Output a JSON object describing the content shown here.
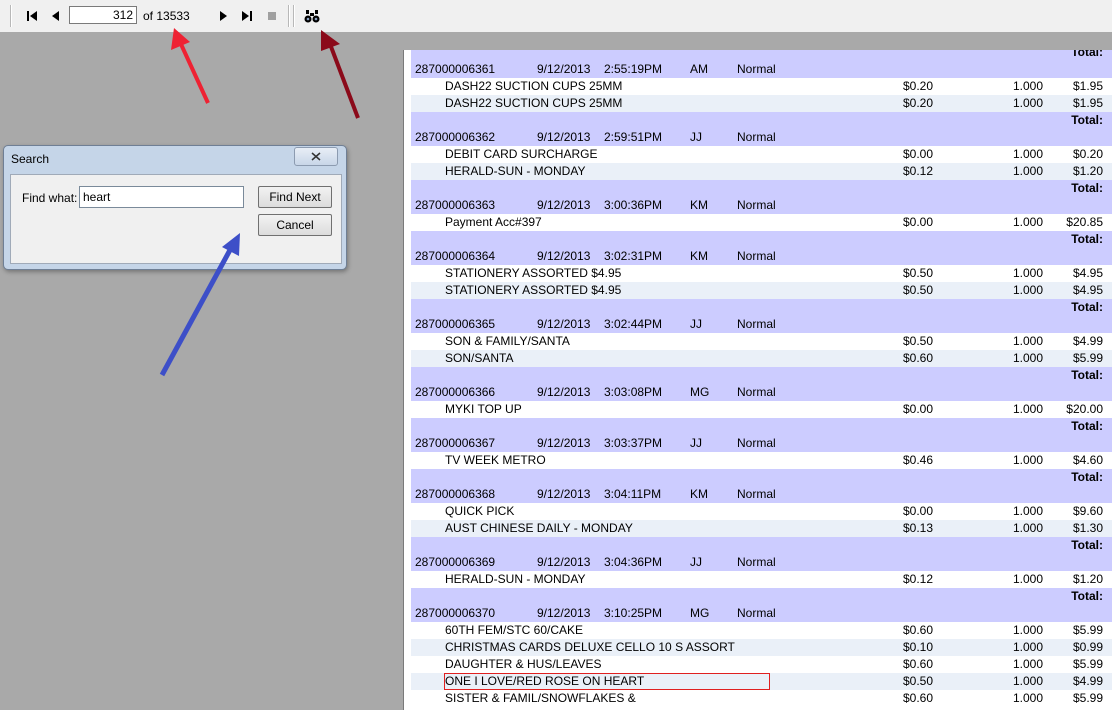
{
  "toolbar": {
    "page_current": "312",
    "page_total_label": "of 13533",
    "icons": [
      "first-page-icon",
      "prev-page-icon",
      "next-page-icon",
      "last-page-icon",
      "stop-icon",
      "binoculars-icon"
    ]
  },
  "dialog": {
    "title": "Search",
    "find_label": "Find what:",
    "find_value": "heart",
    "find_next_label": "Find Next",
    "cancel_label": "Cancel"
  },
  "report": {
    "total_label": "Total:",
    "rows": [
      {
        "type": "total"
      },
      {
        "type": "header",
        "id": "287000006361",
        "date": "9/12/2013",
        "time": "2:55:19PM",
        "user": "AM",
        "status": "Normal"
      },
      {
        "type": "item",
        "desc": "DASH22 SUCTION CUPS 25MM",
        "price": "$0.20",
        "qty": "1.000",
        "amount": "$1.95"
      },
      {
        "type": "item",
        "desc": "DASH22 SUCTION CUPS 25MM",
        "price": "$0.20",
        "qty": "1.000",
        "amount": "$1.95"
      },
      {
        "type": "total"
      },
      {
        "type": "header",
        "id": "287000006362",
        "date": "9/12/2013",
        "time": "2:59:51PM",
        "user": "JJ",
        "status": "Normal"
      },
      {
        "type": "item",
        "desc": "DEBIT CARD SURCHARGE",
        "price": "$0.00",
        "qty": "1.000",
        "amount": "$0.20"
      },
      {
        "type": "item",
        "desc": "HERALD-SUN - MONDAY",
        "price": "$0.12",
        "qty": "1.000",
        "amount": "$1.20"
      },
      {
        "type": "total"
      },
      {
        "type": "header",
        "id": "287000006363",
        "date": "9/12/2013",
        "time": "3:00:36PM",
        "user": "KM",
        "status": "Normal"
      },
      {
        "type": "item",
        "desc": "Payment Acc#397",
        "price": "$0.00",
        "qty": "1.000",
        "amount": "$20.85"
      },
      {
        "type": "total"
      },
      {
        "type": "header",
        "id": "287000006364",
        "date": "9/12/2013",
        "time": "3:02:31PM",
        "user": "KM",
        "status": "Normal"
      },
      {
        "type": "item",
        "desc": "STATIONERY ASSORTED $4.95",
        "price": "$0.50",
        "qty": "1.000",
        "amount": "$4.95"
      },
      {
        "type": "item",
        "desc": "STATIONERY ASSORTED $4.95",
        "price": "$0.50",
        "qty": "1.000",
        "amount": "$4.95"
      },
      {
        "type": "total"
      },
      {
        "type": "header",
        "id": "287000006365",
        "date": "9/12/2013",
        "time": "3:02:44PM",
        "user": "JJ",
        "status": "Normal"
      },
      {
        "type": "item",
        "desc": "SON & FAMILY/SANTA",
        "price": "$0.50",
        "qty": "1.000",
        "amount": "$4.99"
      },
      {
        "type": "item",
        "desc": "SON/SANTA",
        "price": "$0.60",
        "qty": "1.000",
        "amount": "$5.99"
      },
      {
        "type": "total"
      },
      {
        "type": "header",
        "id": "287000006366",
        "date": "9/12/2013",
        "time": "3:03:08PM",
        "user": "MG",
        "status": "Normal"
      },
      {
        "type": "item",
        "desc": "MYKI TOP UP",
        "price": "$0.00",
        "qty": "1.000",
        "amount": "$20.00"
      },
      {
        "type": "total"
      },
      {
        "type": "header",
        "id": "287000006367",
        "date": "9/12/2013",
        "time": "3:03:37PM",
        "user": "JJ",
        "status": "Normal"
      },
      {
        "type": "item",
        "desc": "TV WEEK METRO",
        "price": "$0.46",
        "qty": "1.000",
        "amount": "$4.60"
      },
      {
        "type": "total"
      },
      {
        "type": "header",
        "id": "287000006368",
        "date": "9/12/2013",
        "time": "3:04:11PM",
        "user": "KM",
        "status": "Normal"
      },
      {
        "type": "item",
        "desc": "QUICK PICK",
        "price": "$0.00",
        "qty": "1.000",
        "amount": "$9.60"
      },
      {
        "type": "item",
        "desc": "AUST CHINESE DAILY - MONDAY",
        "price": "$0.13",
        "qty": "1.000",
        "amount": "$1.30"
      },
      {
        "type": "total"
      },
      {
        "type": "header",
        "id": "287000006369",
        "date": "9/12/2013",
        "time": "3:04:36PM",
        "user": "JJ",
        "status": "Normal"
      },
      {
        "type": "item",
        "desc": "HERALD-SUN - MONDAY",
        "price": "$0.12",
        "qty": "1.000",
        "amount": "$1.20"
      },
      {
        "type": "total"
      },
      {
        "type": "header",
        "id": "287000006370",
        "date": "9/12/2013",
        "time": "3:10:25PM",
        "user": "MG",
        "status": "Normal"
      },
      {
        "type": "item",
        "desc": "60TH FEM/STC 60/CAKE",
        "price": "$0.60",
        "qty": "1.000",
        "amount": "$5.99"
      },
      {
        "type": "item",
        "desc": "CHRISTMAS CARDS DELUXE CELLO 10 S ASSORT",
        "price": "$0.10",
        "qty": "1.000",
        "amount": "$0.99"
      },
      {
        "type": "item",
        "desc": "DAUGHTER & HUS/LEAVES",
        "price": "$0.60",
        "qty": "1.000",
        "amount": "$5.99"
      },
      {
        "type": "item",
        "desc": "ONE I LOVE/RED ROSE ON HEART",
        "price": "$0.50",
        "qty": "1.000",
        "amount": "$4.99",
        "highlight": true
      },
      {
        "type": "item",
        "desc": "SISTER & FAMIL/SNOWFLAKES &",
        "price": "$0.60",
        "qty": "1.000",
        "amount": "$5.99"
      }
    ]
  },
  "colors": {
    "header_band": "#ccccff",
    "alt_row": "#eaf0f8",
    "highlight_border": "#e02020",
    "arrow_red": "#ee2233",
    "arrow_darkred": "#8b0a1a",
    "arrow_blue": "#3d4fc8"
  }
}
